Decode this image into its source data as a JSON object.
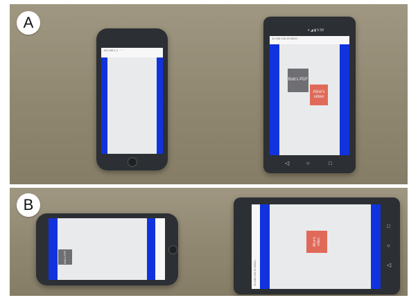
{
  "labels": {
    "panel_a": "A",
    "panel_b": "B"
  },
  "panel_a": {
    "iphone": {
      "url": "192.168.1.2 · ····"
    },
    "android": {
      "url": "10.186.134.15:3000/…",
      "status": "▾ ◢ ▮ 5:58",
      "grey_box": "Bob's PDF",
      "red_box_line1": "Alice's",
      "red_box_line2": "video",
      "nav": [
        "◁",
        "○",
        "□"
      ]
    }
  },
  "panel_b": {
    "iphone": {
      "grey_box": "Bob's PDF",
      "url": "192.168.1.2 · ····"
    },
    "android": {
      "url": "10.186.134.15:3000/…",
      "red_box_line1": "Alice's",
      "red_box_line2": "video",
      "nav": [
        "□",
        "○",
        "◁"
      ]
    }
  },
  "colors": {
    "background": "#8f8770",
    "accent_blue": "#1133dd",
    "red_box": "#e06a59",
    "grey_box": "#6e6e73"
  }
}
